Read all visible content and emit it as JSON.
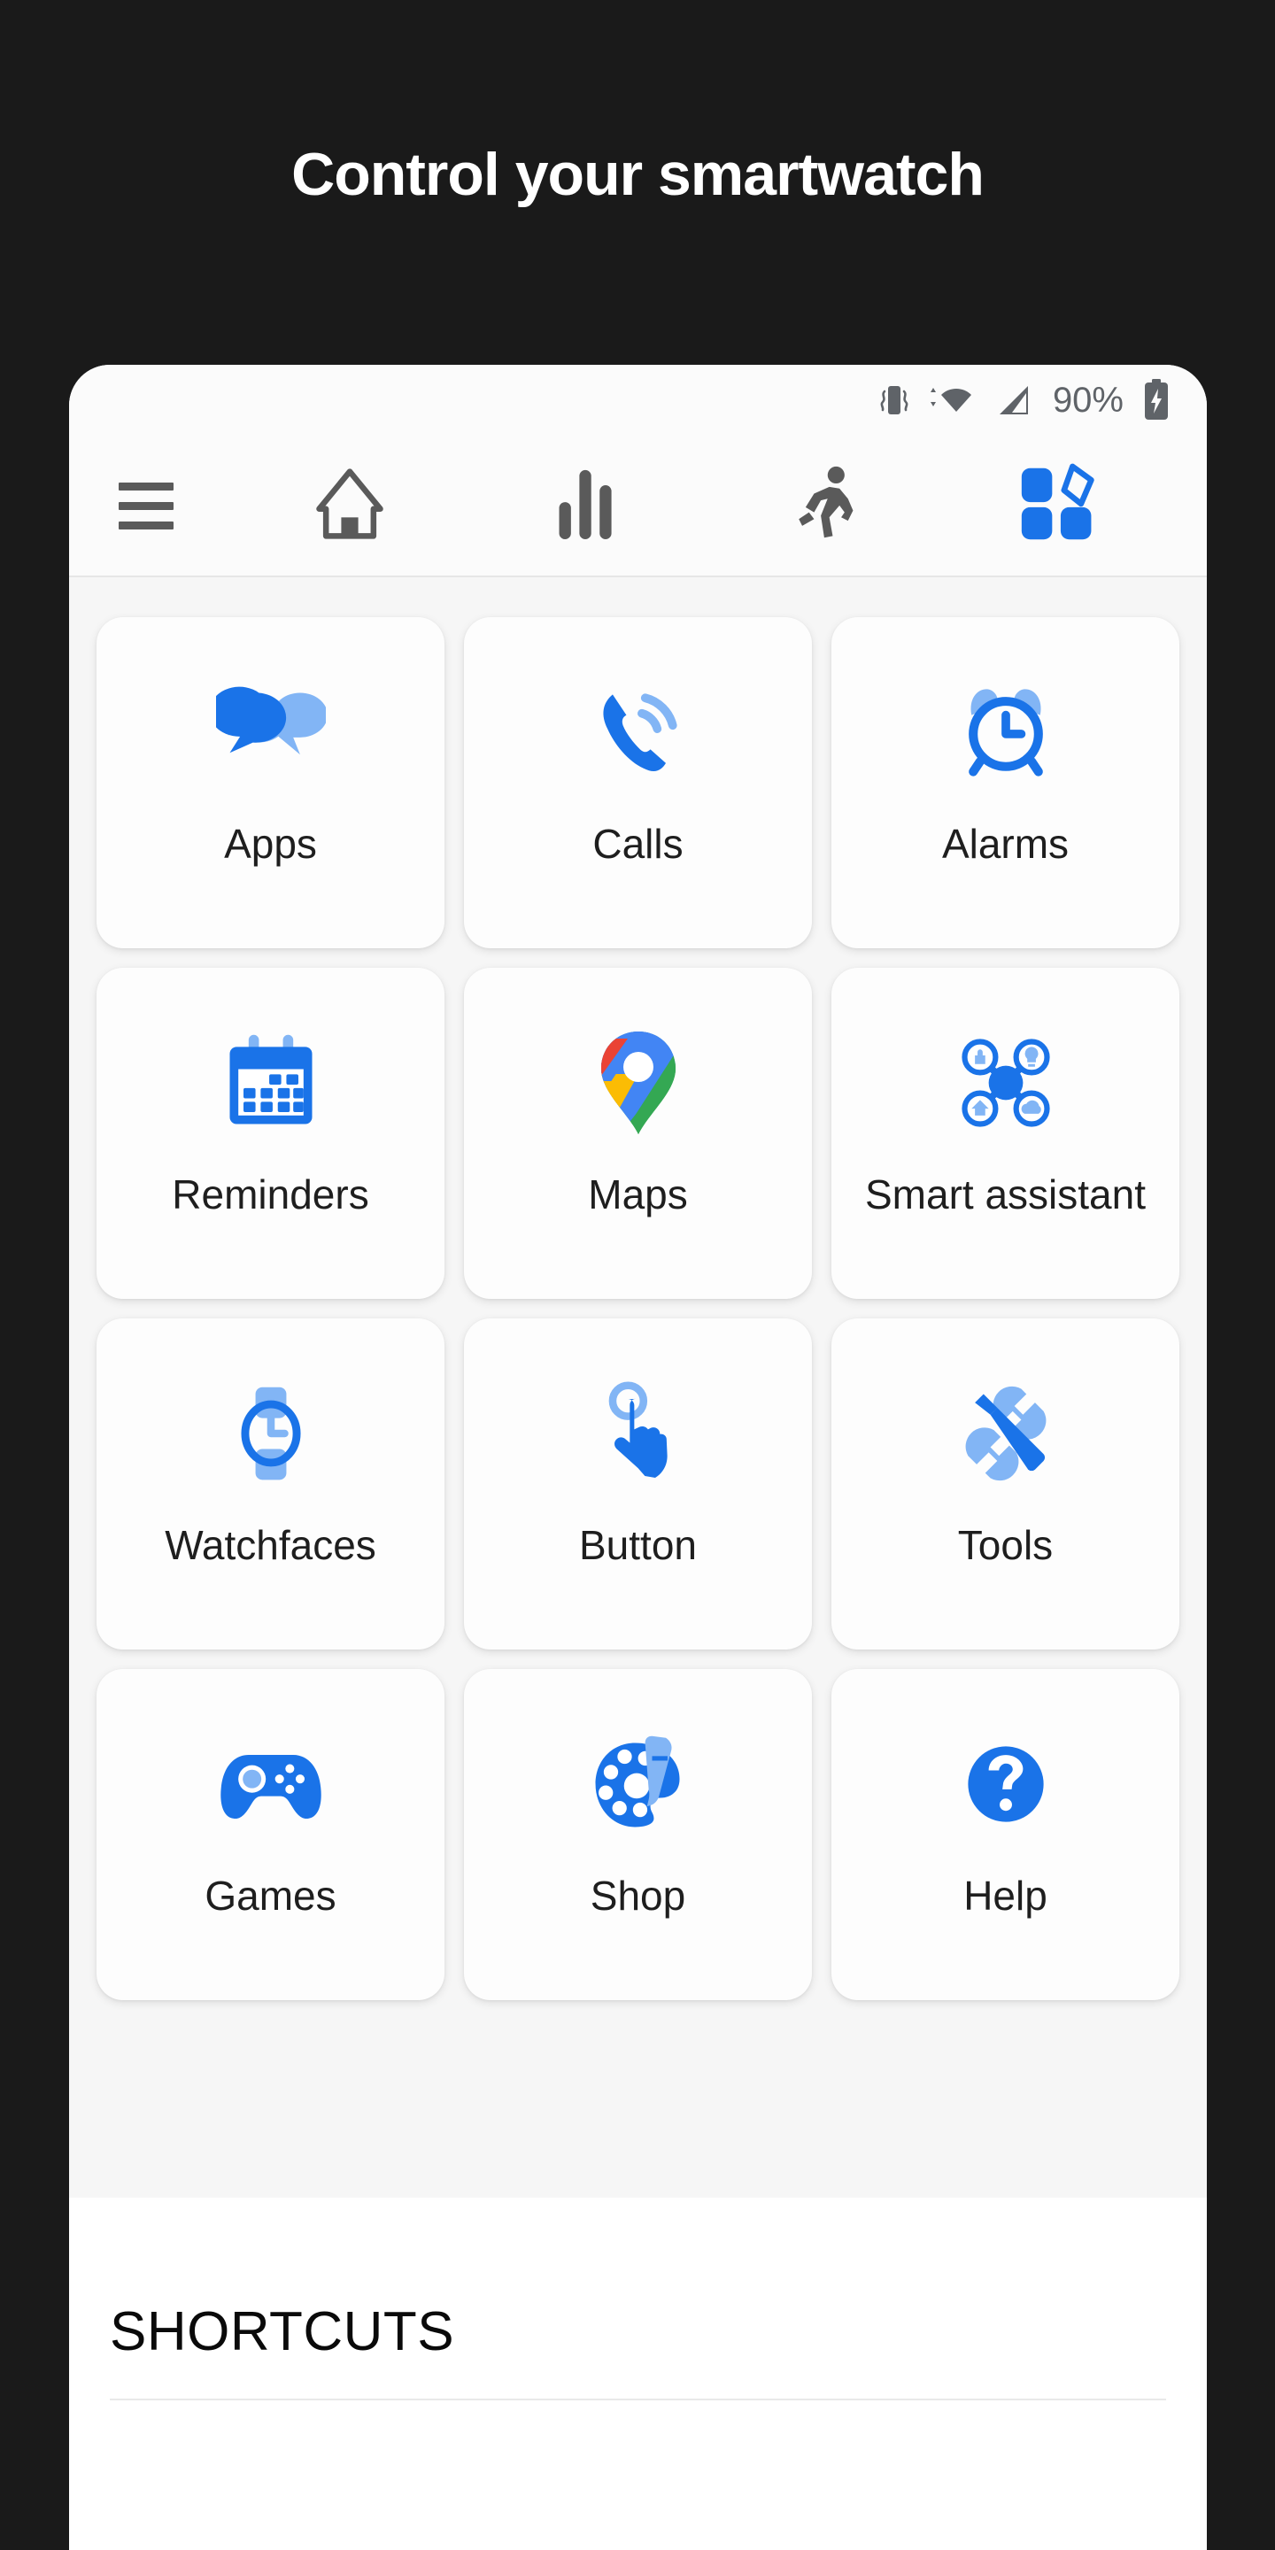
{
  "headline": "Control your smartwatch",
  "colors": {
    "page_background": "#1a1a1a",
    "accent_blue": "#1a73e8",
    "accent_blue_light": "#82b5f5",
    "tile_background": "#fdfdfd",
    "screen_background": "#f6f6f6"
  },
  "statusbar": {
    "battery_percent": "90%",
    "icons": [
      "vibrate-icon",
      "wifi-icon",
      "signal-icon",
      "battery-charging-icon"
    ]
  },
  "navbar": {
    "items": [
      {
        "id": "menu",
        "icon": "hamburger-menu-icon",
        "active": false
      },
      {
        "id": "home",
        "icon": "home-icon",
        "active": false
      },
      {
        "id": "stats",
        "icon": "bar-chart-icon",
        "active": false
      },
      {
        "id": "activity",
        "icon": "running-person-icon",
        "active": false
      },
      {
        "id": "apps",
        "icon": "apps-grid-icon",
        "active": true
      }
    ]
  },
  "tiles": [
    {
      "label": "Apps",
      "icon": "chat-bubbles-icon"
    },
    {
      "label": "Calls",
      "icon": "phone-ringing-icon"
    },
    {
      "label": "Alarms",
      "icon": "alarm-clock-icon"
    },
    {
      "label": "Reminders",
      "icon": "calendar-icon"
    },
    {
      "label": "Maps",
      "icon": "google-maps-pin-icon"
    },
    {
      "label": "Smart assistant",
      "icon": "smart-hub-icon"
    },
    {
      "label": "Watchfaces",
      "icon": "watch-icon"
    },
    {
      "label": "Button",
      "icon": "tap-hand-icon"
    },
    {
      "label": "Tools",
      "icon": "screwdriver-wrench-icon"
    },
    {
      "label": "Games",
      "icon": "gamepad-icon"
    },
    {
      "label": "Shop",
      "icon": "paint-palette-icon"
    },
    {
      "label": "Help",
      "icon": "question-mark-circle-icon"
    }
  ],
  "shortcuts": {
    "title": "SHORTCUTS"
  }
}
